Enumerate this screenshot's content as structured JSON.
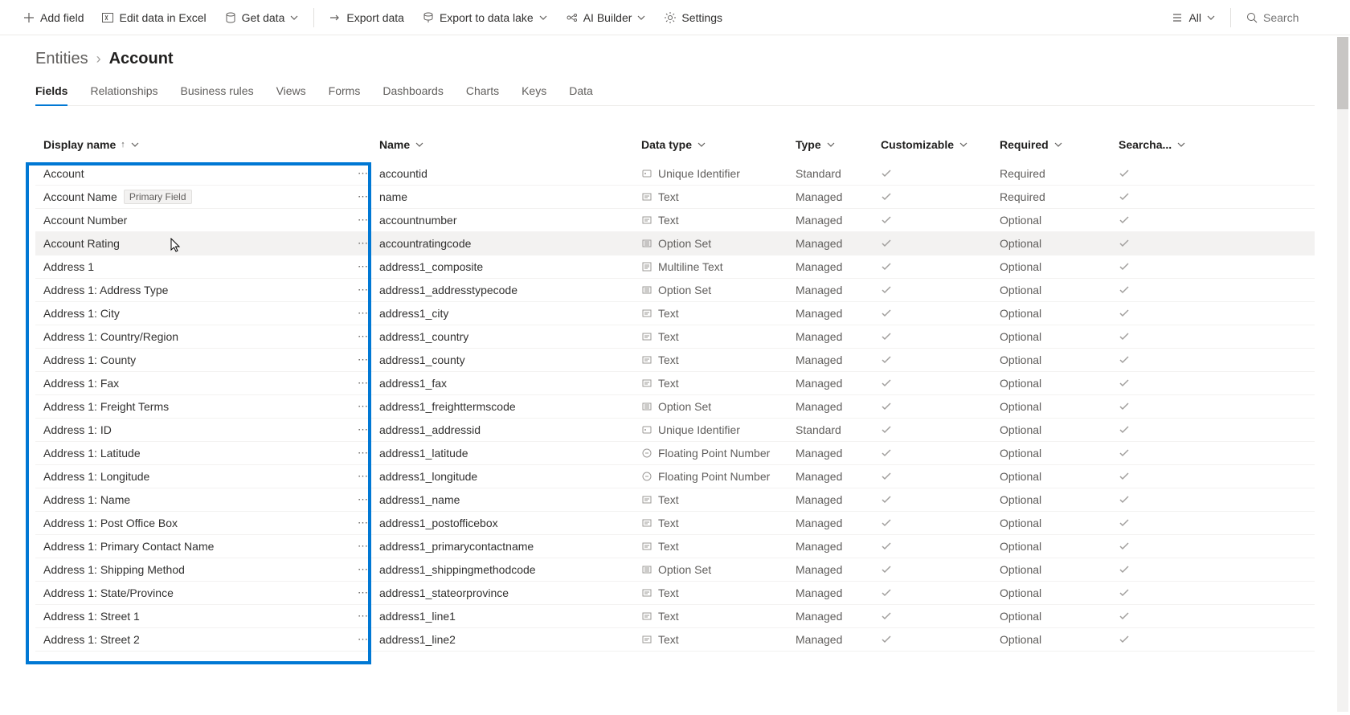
{
  "toolbar": {
    "add_field": "Add field",
    "edit_excel": "Edit data in Excel",
    "get_data": "Get data",
    "export_data": "Export data",
    "export_datalake": "Export to data lake",
    "ai_builder": "AI Builder",
    "settings": "Settings",
    "filter_all": "All",
    "search_placeholder": "Search"
  },
  "breadcrumb": {
    "parent": "Entities",
    "current": "Account"
  },
  "tabs": [
    "Fields",
    "Relationships",
    "Business rules",
    "Views",
    "Forms",
    "Dashboards",
    "Charts",
    "Keys",
    "Data"
  ],
  "active_tab": 0,
  "columns": {
    "display": "Display name",
    "name": "Name",
    "datatype": "Data type",
    "type": "Type",
    "customizable": "Customizable",
    "required": "Required",
    "searchable": "Searcha..."
  },
  "badge_primary": "Primary Field",
  "rows": [
    {
      "display": "Account",
      "name": "accountid",
      "datatype": "Unique Identifier",
      "dticon": "key",
      "type": "Standard",
      "cust": true,
      "req": "Required",
      "search": true
    },
    {
      "display": "Account Name",
      "badge": true,
      "name": "name",
      "datatype": "Text",
      "dticon": "text",
      "type": "Managed",
      "cust": true,
      "req": "Required",
      "search": true
    },
    {
      "display": "Account Number",
      "name": "accountnumber",
      "datatype": "Text",
      "dticon": "text",
      "type": "Managed",
      "cust": true,
      "req": "Optional",
      "search": true
    },
    {
      "display": "Account Rating",
      "name": "accountratingcode",
      "datatype": "Option Set",
      "dticon": "list",
      "type": "Managed",
      "cust": true,
      "req": "Optional",
      "search": true,
      "hovered": true
    },
    {
      "display": "Address 1",
      "name": "address1_composite",
      "datatype": "Multiline Text",
      "dticon": "multiline",
      "type": "Managed",
      "cust": true,
      "req": "Optional",
      "search": true
    },
    {
      "display": "Address 1: Address Type",
      "name": "address1_addresstypecode",
      "datatype": "Option Set",
      "dticon": "list",
      "type": "Managed",
      "cust": true,
      "req": "Optional",
      "search": true
    },
    {
      "display": "Address 1: City",
      "name": "address1_city",
      "datatype": "Text",
      "dticon": "text",
      "type": "Managed",
      "cust": true,
      "req": "Optional",
      "search": true
    },
    {
      "display": "Address 1: Country/Region",
      "name": "address1_country",
      "datatype": "Text",
      "dticon": "text",
      "type": "Managed",
      "cust": true,
      "req": "Optional",
      "search": true
    },
    {
      "display": "Address 1: County",
      "name": "address1_county",
      "datatype": "Text",
      "dticon": "text",
      "type": "Managed",
      "cust": true,
      "req": "Optional",
      "search": true
    },
    {
      "display": "Address 1: Fax",
      "name": "address1_fax",
      "datatype": "Text",
      "dticon": "text",
      "type": "Managed",
      "cust": true,
      "req": "Optional",
      "search": true
    },
    {
      "display": "Address 1: Freight Terms",
      "name": "address1_freighttermscode",
      "datatype": "Option Set",
      "dticon": "list",
      "type": "Managed",
      "cust": true,
      "req": "Optional",
      "search": true
    },
    {
      "display": "Address 1: ID",
      "name": "address1_addressid",
      "datatype": "Unique Identifier",
      "dticon": "key",
      "type": "Standard",
      "cust": true,
      "req": "Optional",
      "search": true
    },
    {
      "display": "Address 1: Latitude",
      "name": "address1_latitude",
      "datatype": "Floating Point Number",
      "dticon": "float",
      "type": "Managed",
      "cust": true,
      "req": "Optional",
      "search": true
    },
    {
      "display": "Address 1: Longitude",
      "name": "address1_longitude",
      "datatype": "Floating Point Number",
      "dticon": "float",
      "type": "Managed",
      "cust": true,
      "req": "Optional",
      "search": true
    },
    {
      "display": "Address 1: Name",
      "name": "address1_name",
      "datatype": "Text",
      "dticon": "text",
      "type": "Managed",
      "cust": true,
      "req": "Optional",
      "search": true
    },
    {
      "display": "Address 1: Post Office Box",
      "name": "address1_postofficebox",
      "datatype": "Text",
      "dticon": "text",
      "type": "Managed",
      "cust": true,
      "req": "Optional",
      "search": true
    },
    {
      "display": "Address 1: Primary Contact Name",
      "name": "address1_primarycontactname",
      "datatype": "Text",
      "dticon": "text",
      "type": "Managed",
      "cust": true,
      "req": "Optional",
      "search": true
    },
    {
      "display": "Address 1: Shipping Method",
      "name": "address1_shippingmethodcode",
      "datatype": "Option Set",
      "dticon": "list",
      "type": "Managed",
      "cust": true,
      "req": "Optional",
      "search": true
    },
    {
      "display": "Address 1: State/Province",
      "name": "address1_stateorprovince",
      "datatype": "Text",
      "dticon": "text",
      "type": "Managed",
      "cust": true,
      "req": "Optional",
      "search": true
    },
    {
      "display": "Address 1: Street 1",
      "name": "address1_line1",
      "datatype": "Text",
      "dticon": "text",
      "type": "Managed",
      "cust": true,
      "req": "Optional",
      "search": true
    },
    {
      "display": "Address 1: Street 2",
      "name": "address1_line2",
      "datatype": "Text",
      "dticon": "text",
      "type": "Managed",
      "cust": true,
      "req": "Optional",
      "search": true
    }
  ]
}
